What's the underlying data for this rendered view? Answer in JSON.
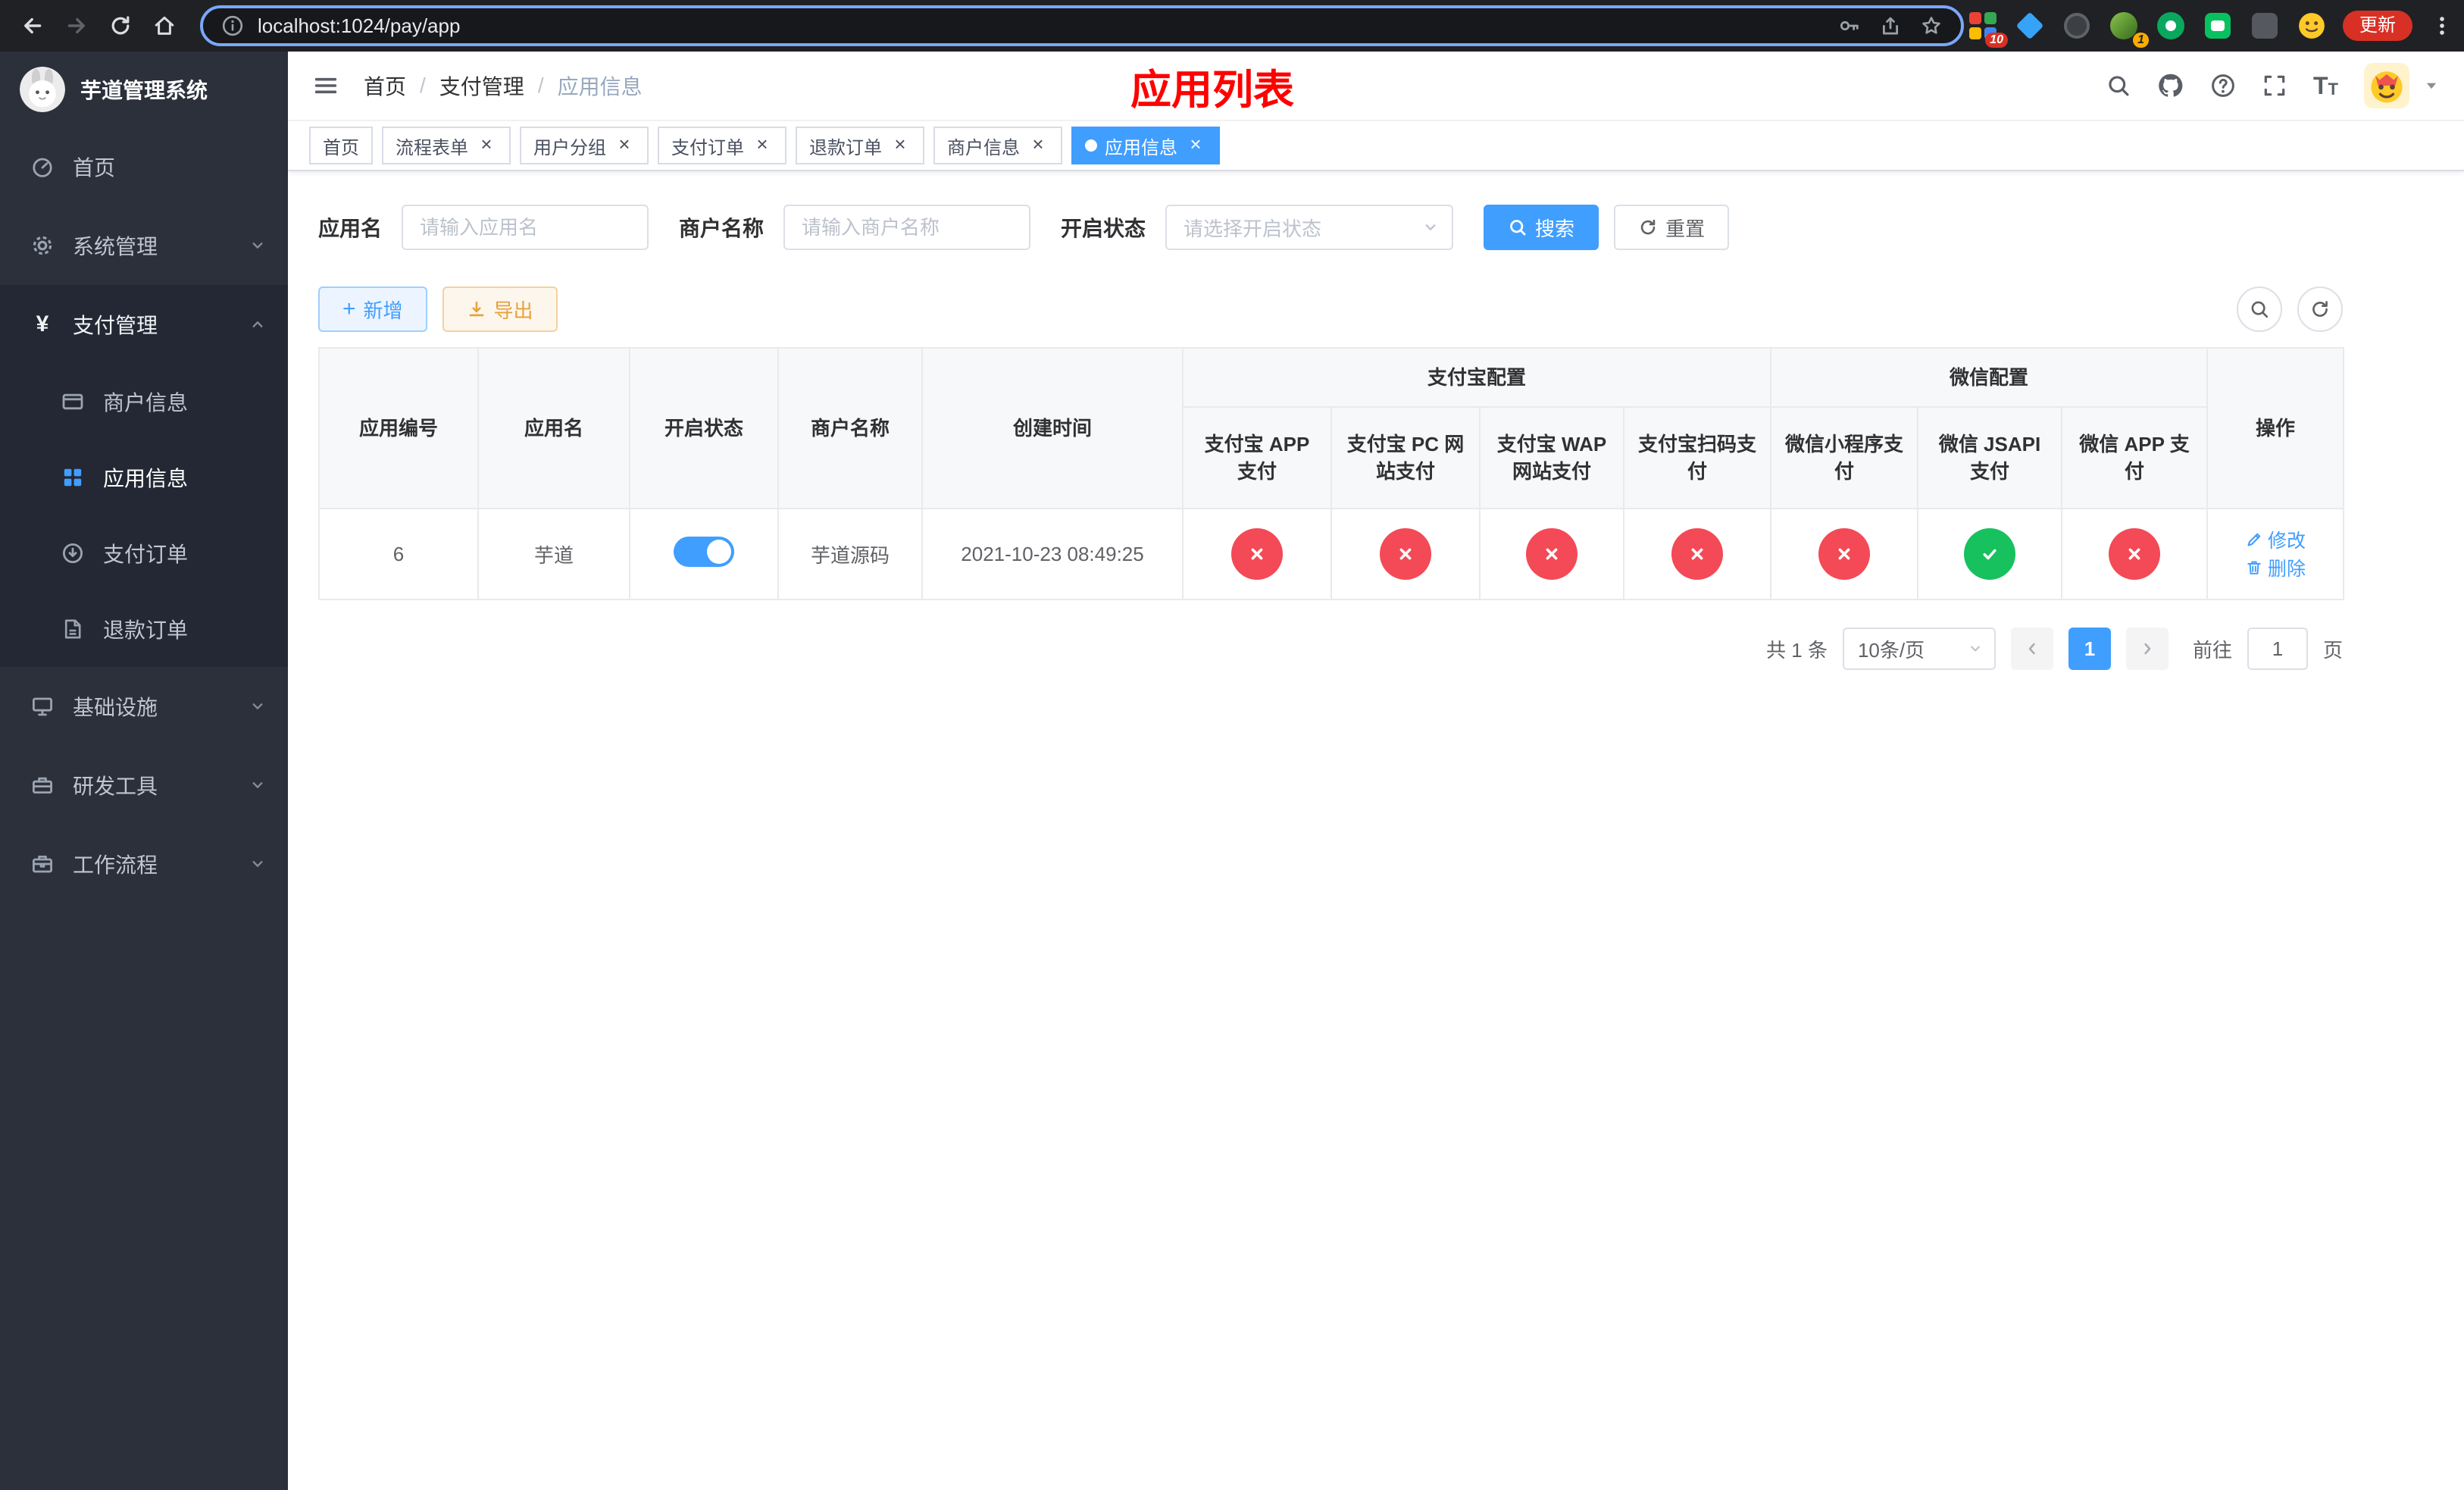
{
  "colors": {
    "accent": "#409eff",
    "danger": "#f44956",
    "success": "#17c15e",
    "title_red": "#ff0000",
    "sidebar_bg": "#2b303b"
  },
  "icons": [
    "back-icon",
    "forward-icon",
    "reload-icon",
    "home-icon",
    "site-info-icon",
    "key-icon",
    "share-icon",
    "star-icon",
    "more-menu-icon",
    "dashboard-icon",
    "gear-icon",
    "yen-icon",
    "merchant-card-icon",
    "app-grid-icon",
    "pay-order-icon",
    "refund-doc-icon",
    "infra-monitor-icon",
    "devtools-box-icon",
    "workflow-case-icon",
    "chevron-down-icon",
    "chevron-up-icon",
    "hamburger-icon",
    "search-icon",
    "github-icon",
    "help-icon",
    "fullscreen-icon",
    "font-size-icon",
    "caret-down-icon",
    "close-icon",
    "plus-icon",
    "download-icon",
    "refresh-icon",
    "edit-icon",
    "delete-icon",
    "x-mark-icon",
    "check-icon"
  ],
  "browser": {
    "url": "localhost:1024/pay/app",
    "update_label": "更新",
    "ext_badge_grid": "10",
    "ext_badge_avatar": "1"
  },
  "sidebar": {
    "title": "芋道管理系统",
    "items": [
      {
        "label": "首页"
      },
      {
        "label": "系统管理"
      },
      {
        "label": "支付管理"
      },
      {
        "label": "基础设施"
      },
      {
        "label": "研发工具"
      },
      {
        "label": "工作流程"
      }
    ],
    "submenu": [
      {
        "label": "商户信息"
      },
      {
        "label": "应用信息"
      },
      {
        "label": "支付订单"
      },
      {
        "label": "退款订单"
      }
    ]
  },
  "header": {
    "breadcrumb": [
      "首页",
      "支付管理",
      "应用信息"
    ],
    "title": "应用列表"
  },
  "tabs": [
    {
      "label": "首页"
    },
    {
      "label": "流程表单"
    },
    {
      "label": "用户分组"
    },
    {
      "label": "支付订单"
    },
    {
      "label": "退款订单"
    },
    {
      "label": "商户信息"
    },
    {
      "label": "应用信息"
    }
  ],
  "filter": {
    "app_name_label": "应用名",
    "app_name_placeholder": "请输入应用名",
    "merchant_label": "商户名称",
    "merchant_placeholder": "请输入商户名称",
    "status_label": "开启状态",
    "status_placeholder": "请选择开启状态",
    "search_label": "搜索",
    "reset_label": "重置"
  },
  "toolbar": {
    "add_label": "新增",
    "export_label": "导出"
  },
  "table": {
    "headers": {
      "app_id": "应用编号",
      "app_name": "应用名",
      "status": "开启状态",
      "merchant_name": "商户名称",
      "create_time": "创建时间",
      "alipay_group": "支付宝配置",
      "wechat_group": "微信配置",
      "alipay_app": "支付宝 APP 支付",
      "alipay_pc": "支付宝 PC 网站支付",
      "alipay_wap": "支付宝 WAP 网站支付",
      "alipay_qr": "支付宝扫码支付",
      "wechat_lite": "微信小程序支付",
      "wechat_jsapi": "微信 JSAPI 支付",
      "wechat_app": "微信 APP 支付",
      "actions": "操作"
    },
    "rows": [
      {
        "app_id": "6",
        "app_name": "芋道",
        "status_on": true,
        "merchant_name": "芋道源码",
        "create_time": "2021-10-23 08:49:25",
        "alipay_app": "disabled",
        "alipay_pc": "disabled",
        "alipay_wap": "disabled",
        "alipay_qr": "disabled",
        "wechat_lite": "disabled",
        "wechat_jsapi": "enabled",
        "wechat_app": "disabled",
        "edit_label": "修改",
        "delete_label": "删除"
      }
    ]
  },
  "pagination": {
    "total": "共 1 条",
    "page_size": "10条/页",
    "current_page": "1",
    "goto_label": "前往",
    "goto_value": "1",
    "page_unit": "页"
  }
}
